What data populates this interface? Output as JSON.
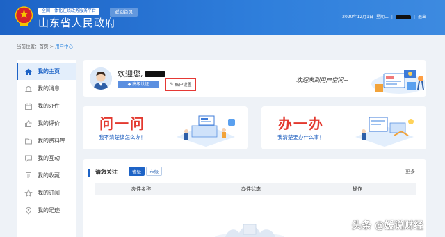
{
  "header": {
    "platform_tag": "全国一体化在线政务服务平台",
    "return_button": "返回首页",
    "title": "山东省人民政府",
    "date": "2020年12月1日",
    "weekday": "星期二",
    "separator": "|",
    "logout": "退出"
  },
  "breadcrumb": {
    "prefix": "当前位置：首页 > ",
    "current": "用户中心"
  },
  "sidebar": {
    "items": [
      {
        "label": "我的主页",
        "icon": "home-icon"
      },
      {
        "label": "我的消息",
        "icon": "bell-icon"
      },
      {
        "label": "我的办件",
        "icon": "calendar-icon"
      },
      {
        "label": "我的评价",
        "icon": "thumbs-up-icon"
      },
      {
        "label": "我的资料库",
        "icon": "folder-icon"
      },
      {
        "label": "我的互动",
        "icon": "chat-icon"
      },
      {
        "label": "我的收藏",
        "icon": "document-icon"
      },
      {
        "label": "我的订阅",
        "icon": "star-icon"
      },
      {
        "label": "我的足迹",
        "icon": "location-icon"
      }
    ]
  },
  "welcome": {
    "greeting": "欢迎您,",
    "auth_badge": "高级认证",
    "settings_button": "账户设置",
    "slogan": "欢迎来到用户空间~"
  },
  "cards": {
    "ask": {
      "title": "问一问",
      "subtitle": "我不清楚该怎么办！"
    },
    "do": {
      "title": "办一办",
      "subtitle": "我清楚要办什么事！"
    }
  },
  "attention": {
    "title": "请您关注",
    "tabs": [
      "省级",
      "市级"
    ],
    "more": "更多",
    "columns": [
      "办件名称",
      "办件状态",
      "操作"
    ]
  },
  "watermark": "头条 @媛说财经",
  "colors": {
    "primary": "#1d63c6",
    "accent_red": "#e3392f",
    "highlight_border": "#e53935"
  }
}
